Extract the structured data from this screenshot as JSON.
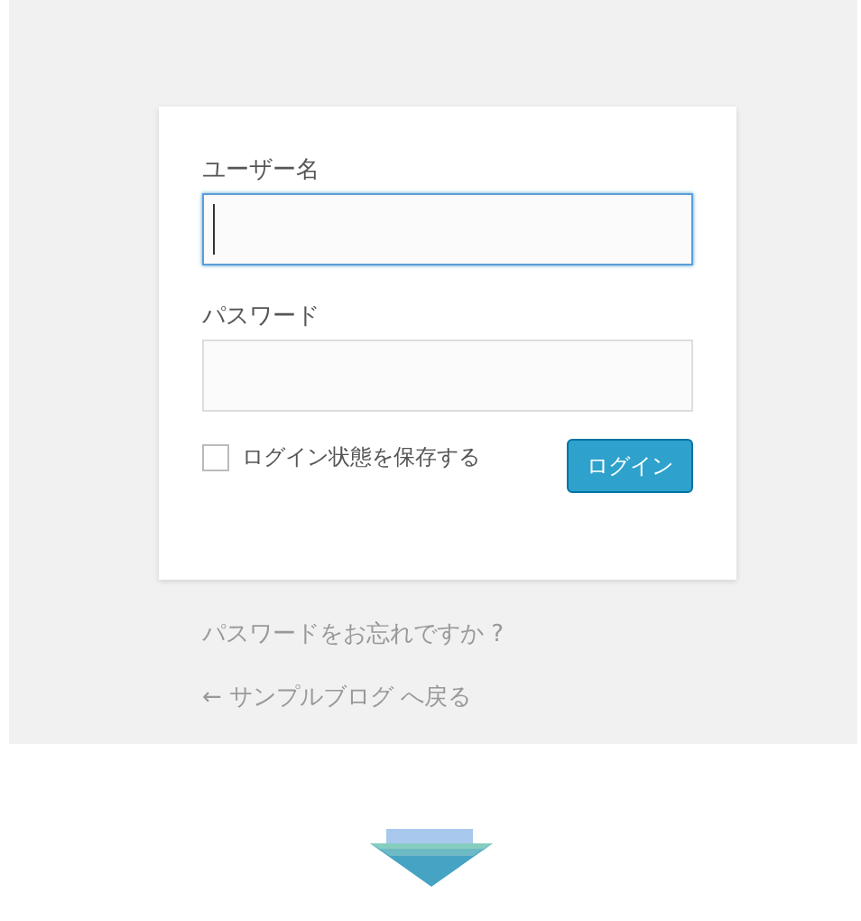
{
  "login_form": {
    "fields": [
      {
        "label": "ユーザー名",
        "focused": true
      },
      {
        "label": "パスワード",
        "focused": false
      }
    ],
    "remember_me": {
      "label": "ログイン状態を保存する",
      "checked": false
    },
    "login_button": "ログイン"
  },
  "links": [
    "パスワードをお忘れですか ?",
    "← サンプルブログ へ戻る"
  ]
}
